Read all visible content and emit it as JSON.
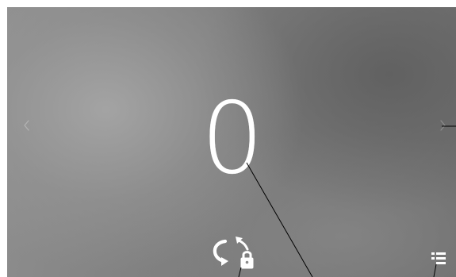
{
  "counter": {
    "value": "0"
  },
  "navigation": {
    "prev_icon": "chevron-left-icon",
    "next_icon": "chevron-right-icon"
  },
  "toolbar": {
    "rotate_icon": "screen-rotation-icon",
    "lock_icon": "rotation-lock-icon",
    "list_icon": "list-menu-icon"
  },
  "colors": {
    "foreground": "#ffffff",
    "background_light": "#a5a5a5",
    "background_dark": "#5f5f5f",
    "annotation_line": "#000000"
  }
}
